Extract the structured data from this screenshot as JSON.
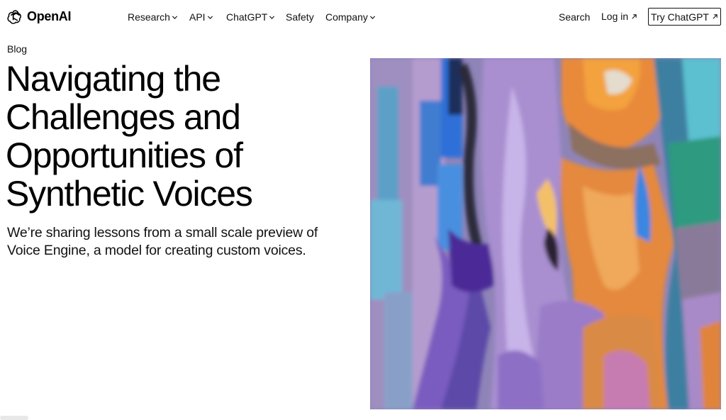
{
  "header": {
    "logo_text": "OpenAI",
    "nav": [
      {
        "label": "Research",
        "has_dropdown": true
      },
      {
        "label": "API",
        "has_dropdown": true
      },
      {
        "label": "ChatGPT",
        "has_dropdown": true
      },
      {
        "label": "Safety",
        "has_dropdown": false
      },
      {
        "label": "Company",
        "has_dropdown": true
      }
    ],
    "search_label": "Search",
    "login_label": "Log in",
    "try_label": "Try ChatGPT"
  },
  "article": {
    "breadcrumb": "Blog",
    "title_lines": [
      "Navigating the",
      "Challenges and",
      "Opportunities of",
      "Synthetic Voices"
    ],
    "subtitle_lines": [
      "We’re sharing lessons from a small scale preview of",
      "Voice Engine, a model for creating custom voices."
    ]
  },
  "colors": {
    "text": "#000000",
    "background": "#ffffff",
    "button_border": "#111111"
  },
  "icons": {
    "logo": "openai-logo-icon",
    "dropdown": "chevron-down-icon",
    "external": "arrow-up-right-icon"
  }
}
